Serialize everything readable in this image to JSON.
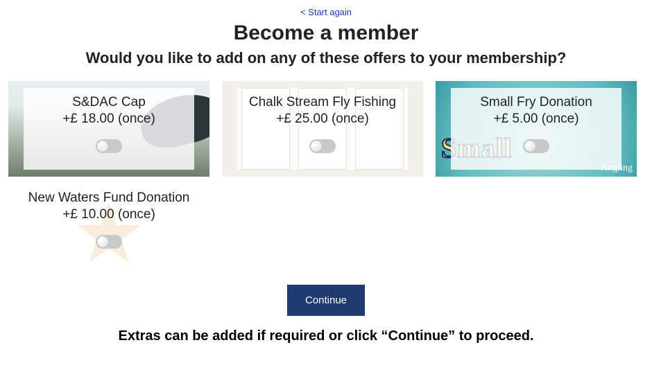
{
  "header": {
    "start_again": "< Start again",
    "title": "Become a member",
    "subtitle": "Would you like to add on any of these offers to your membership?"
  },
  "offers": [
    {
      "title": "S&DAC Cap",
      "price": "+£ 18.00 (once)"
    },
    {
      "title": "Chalk Stream Fly Fishing",
      "price": "+£ 25.00 (once)"
    },
    {
      "title": "Small Fry Donation",
      "price": "+£ 5.00 (once)"
    },
    {
      "title": "New Waters Fund Donation",
      "price": "+£ 10.00 (once)"
    }
  ],
  "continue_label": "Continue",
  "footer_note": "Extras can be added if required or click “Continue” to proceed."
}
